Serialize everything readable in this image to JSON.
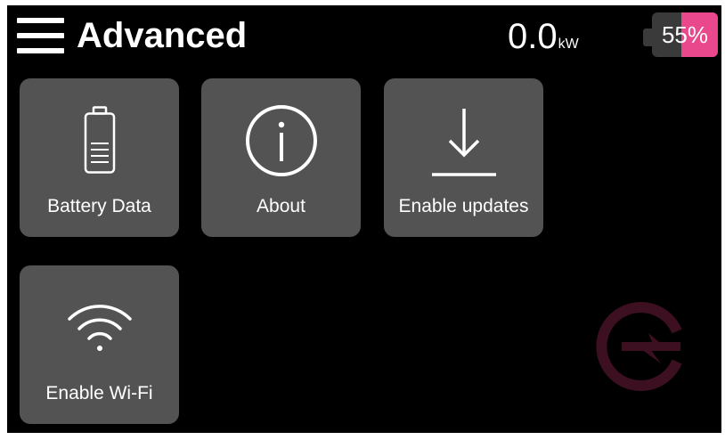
{
  "header": {
    "title": "Advanced",
    "power_value": "0.0",
    "power_unit": "kW",
    "battery_percent_text": "55%",
    "battery_level": 0.55,
    "accent_color": "#e9488c"
  },
  "tiles": [
    {
      "label": "Battery Data",
      "icon": "battery-icon"
    },
    {
      "label": "About",
      "icon": "info-icon"
    },
    {
      "label": "Enable updates",
      "icon": "download-icon"
    },
    {
      "label": "Enable Wi-Fi",
      "icon": "wifi-icon"
    }
  ],
  "colors": {
    "background": "#000000",
    "tile": "#535353",
    "text": "#ffffff",
    "logo": "#3c1020"
  }
}
